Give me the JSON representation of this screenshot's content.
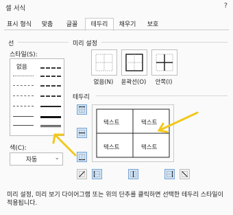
{
  "window": {
    "title": "셀 서식",
    "help": "?"
  },
  "tabs": [
    {
      "label": "표시 형식"
    },
    {
      "label": "맞춤"
    },
    {
      "label": "글꼴"
    },
    {
      "label": "테두리",
      "active": true
    },
    {
      "label": "채우기"
    },
    {
      "label": "보호"
    }
  ],
  "line_section": {
    "title": "선",
    "style_label": "스타일(S):",
    "none_label": "없음",
    "color_label": "색(C):",
    "color_value": "자동"
  },
  "presets_section": {
    "title": "미리 설정",
    "buttons": [
      {
        "label": "없음(N)"
      },
      {
        "label": "윤곽선(O)"
      },
      {
        "label": "안쪽(I)"
      }
    ]
  },
  "border_section": {
    "title": "테두리",
    "cells": [
      "텍스트",
      "텍스트",
      "텍스트",
      "텍스트"
    ]
  },
  "footer": {
    "text": "미리 설정, 미리 보기 다이어그램 또는 위의 단추를 클릭하면 선택한 테두리 스타일이 적용됩니다."
  },
  "colors": {
    "accent": "#4a86c8",
    "annotation": "#f2c81a",
    "active_button": "#cfe3f7"
  }
}
